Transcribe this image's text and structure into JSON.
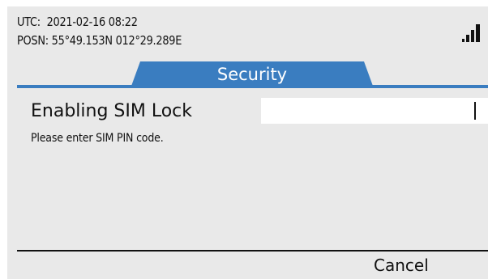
{
  "status": {
    "utc_label": "UTC:",
    "utc_value": "2021-02-16 08:22",
    "posn_label": "POSN:",
    "posn_value": "55°49.153N 012°29.289E",
    "signal_icon": "signal-strength-icon"
  },
  "tabs": [
    {
      "label": "Security",
      "active": true
    }
  ],
  "dialog": {
    "title": "Enabling SIM Lock",
    "pin_value": "",
    "instruction": "Please enter SIM PIN code."
  },
  "footer": {
    "cancel_label": "Cancel"
  },
  "colors": {
    "accent": "#3a7dc0",
    "background": "#e9e9e9",
    "input_background": "#ffffff"
  }
}
